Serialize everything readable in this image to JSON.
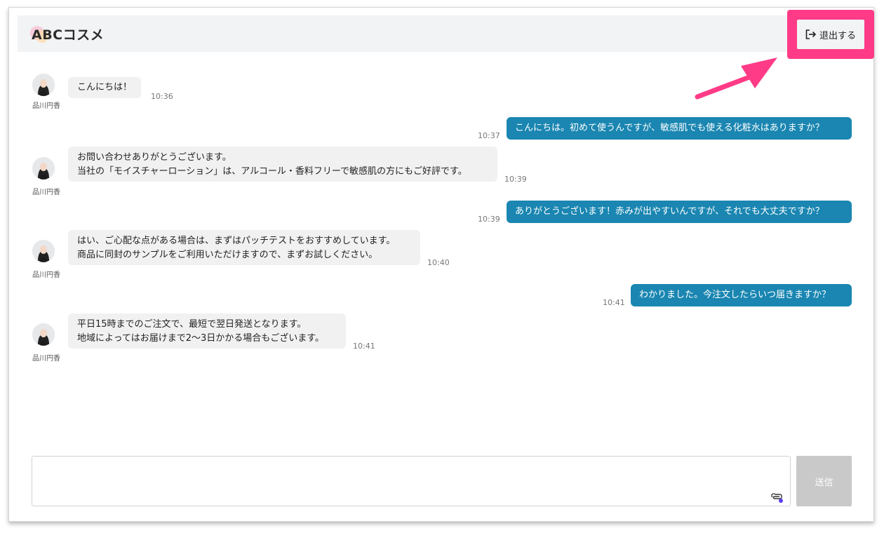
{
  "header": {
    "logo_text": "ABCコスメ",
    "exit_label": "退出する"
  },
  "agent": {
    "name": "品川円香"
  },
  "messages": [
    {
      "from": "agent",
      "lines": [
        "こんにちは！"
      ],
      "time": "10:36"
    },
    {
      "from": "user",
      "text": "こんにちは。初めて使うんですが、敏感肌でも使える化粧水はありますか？",
      "time": "10:37"
    },
    {
      "from": "agent",
      "lines": [
        "お問い合わせありがとうございます。",
        "当社の「モイスチャーローション」は、アルコール・香料フリーで敏感肌の方にもご好評です。"
      ],
      "time": "10:39"
    },
    {
      "from": "user",
      "text": "ありがとうございます！赤みが出やすいんですが、それでも大丈夫ですか？",
      "time": "10:39"
    },
    {
      "from": "agent",
      "lines": [
        "はい、ご心配な点がある場合は、まずはパッチテストをおすすめしています。",
        "商品に同封のサンプルをご利用いただけますので、まずお試しください。"
      ],
      "time": "10:40"
    },
    {
      "from": "user",
      "text": "わかりました。今注文したらいつ届きますか？",
      "time": "10:41"
    },
    {
      "from": "agent",
      "lines": [
        "平日15時までのご注文で、最短で翌日発送となります。",
        "地域によってはお届けまで2〜3日かかる場合もございます。"
      ],
      "time": "10:41"
    }
  ],
  "composer": {
    "value": "",
    "send_label": "送信"
  },
  "colors": {
    "user_bubble": "#1a86b1",
    "agent_bubble": "#f1f1f1",
    "highlight": "#ff3b87",
    "send_disabled": "#c9c9c9"
  }
}
